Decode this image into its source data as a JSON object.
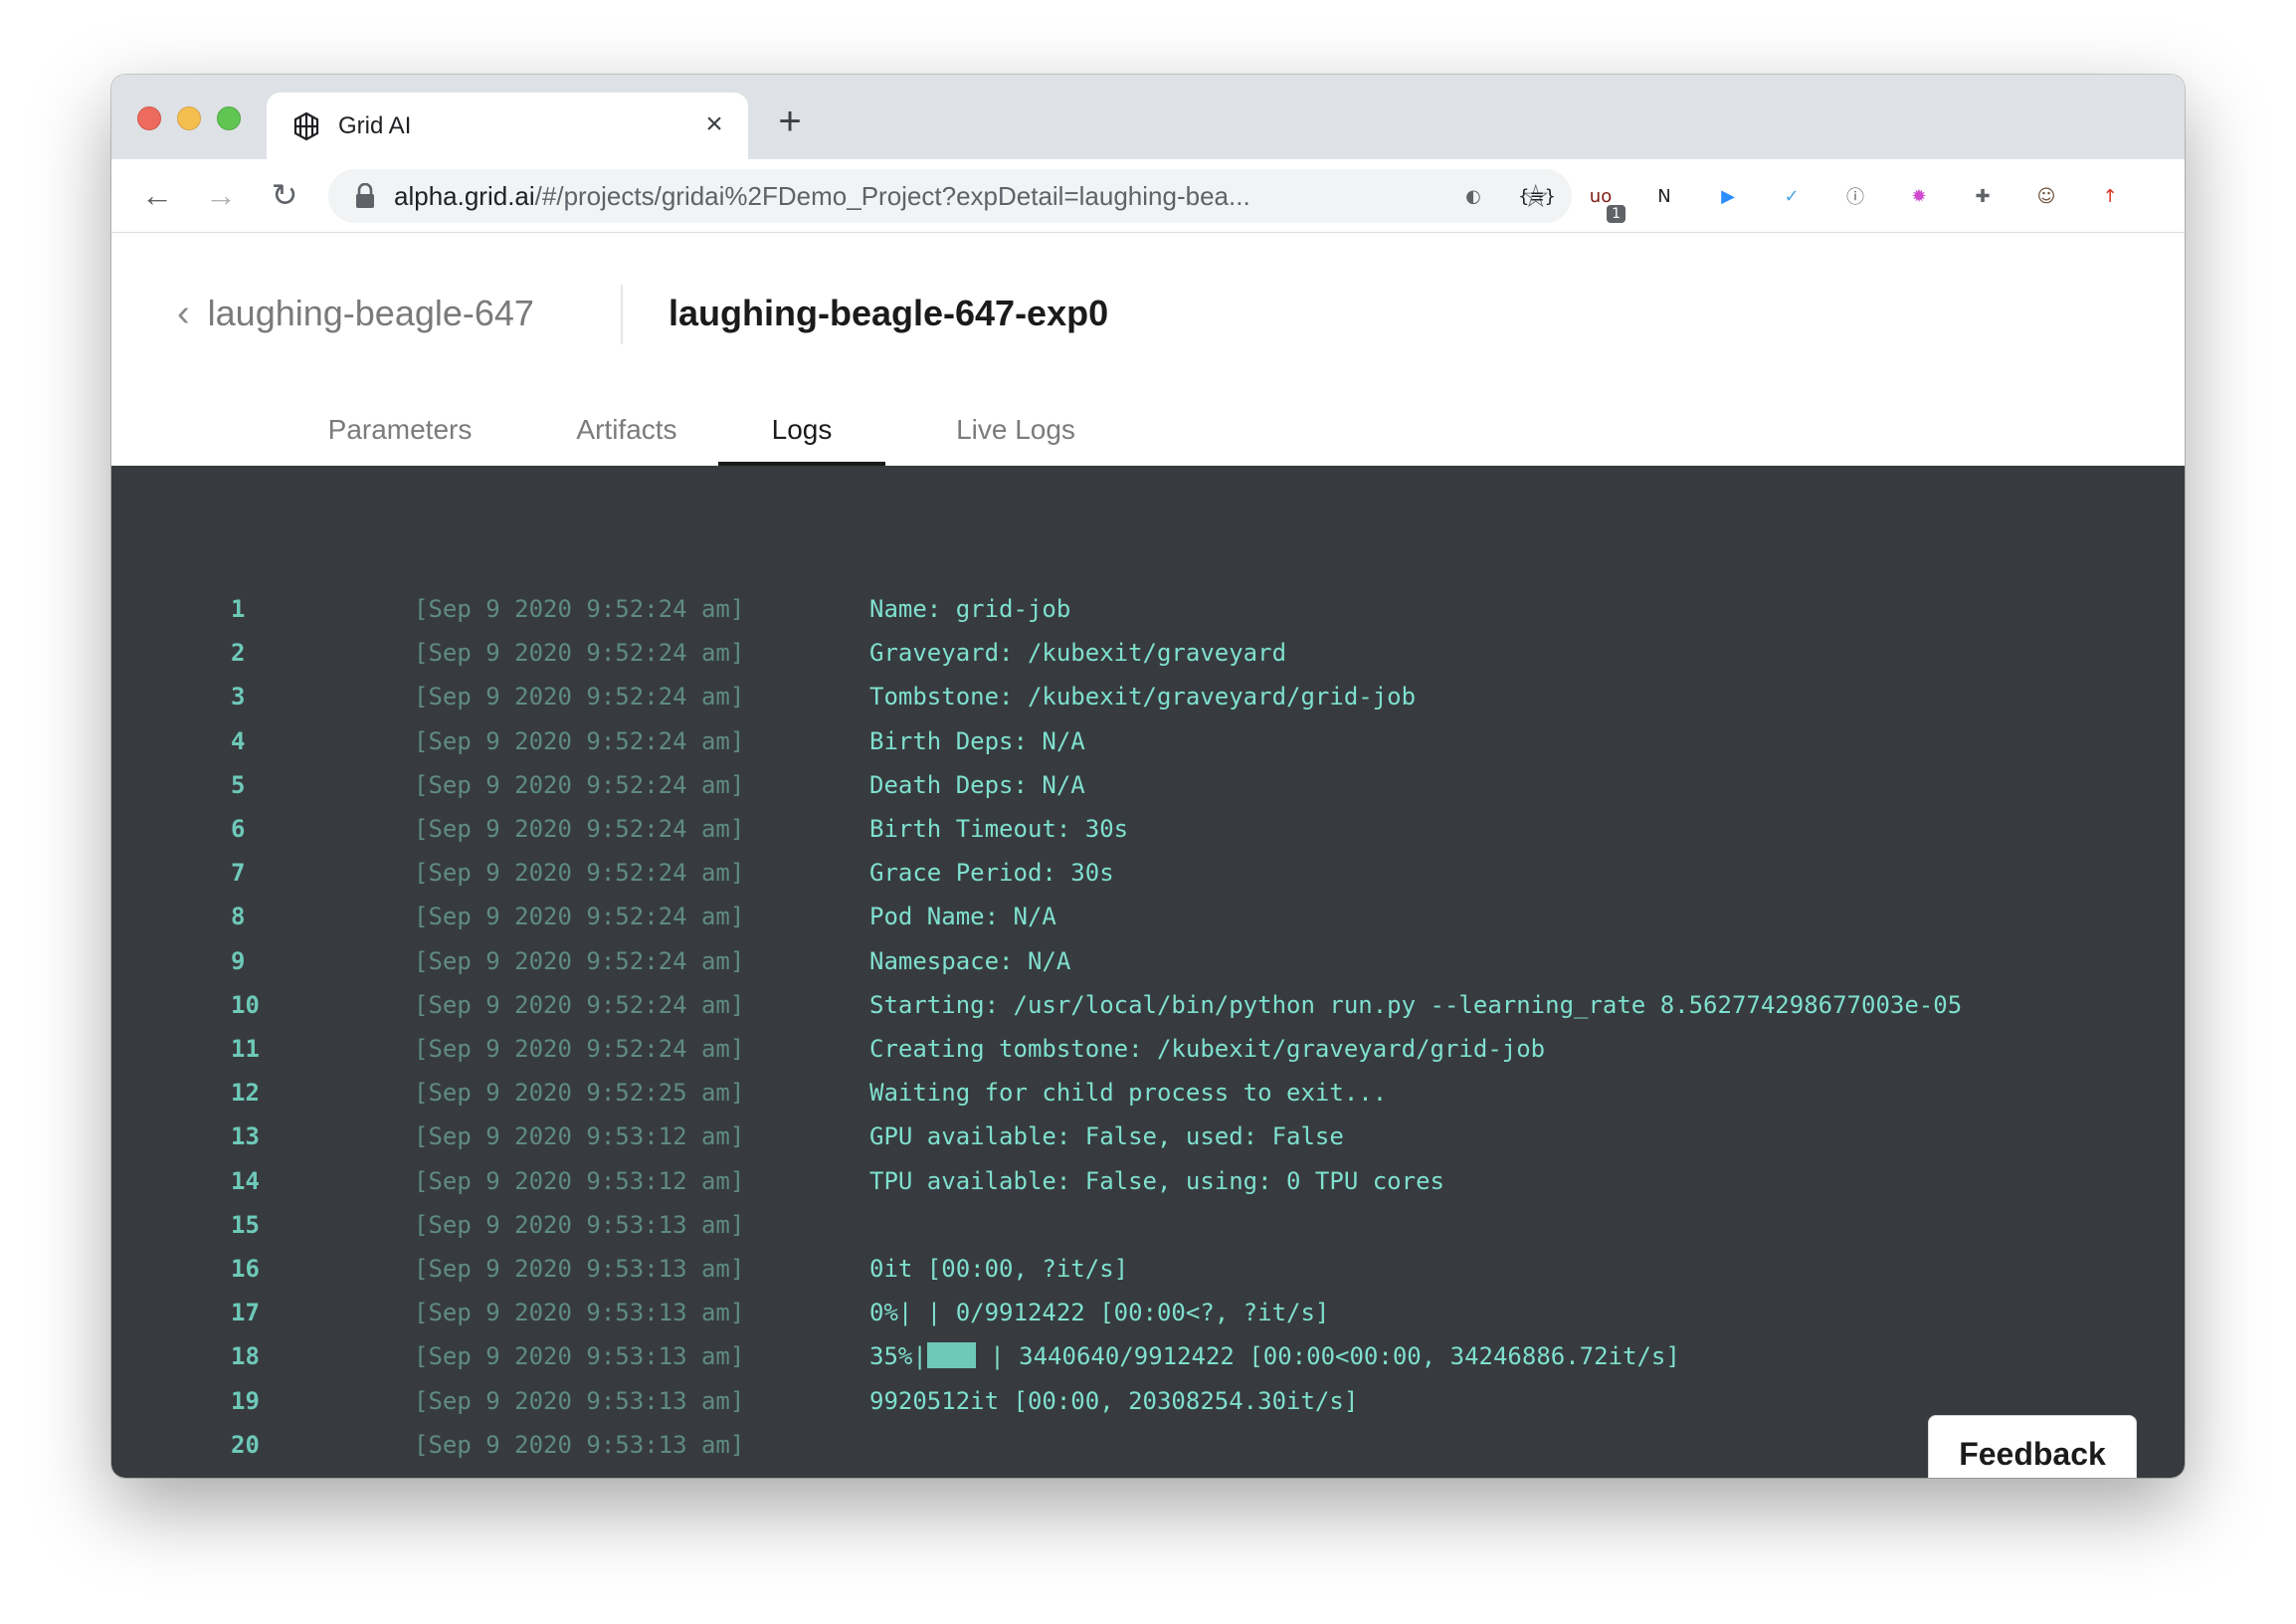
{
  "browser": {
    "tab_title": "Grid AI",
    "tab_close": "×",
    "new_tab": "+",
    "url_host": "alpha.grid.ai",
    "url_path": "/#/projects/gridai%2FDemo_Project?expDetail=laughing-bea...",
    "extensions": [
      {
        "name": "circle-extension-icon",
        "glyph": "◐"
      },
      {
        "name": "json-extension-icon",
        "glyph": "{≡}"
      },
      {
        "name": "ublock-extension-icon",
        "glyph": "uo",
        "badge": "1"
      },
      {
        "name": "notion-extension-icon",
        "glyph": "N"
      },
      {
        "name": "zoom-extension-icon",
        "glyph": "▶"
      },
      {
        "name": "tick-extension-icon",
        "glyph": "✓"
      },
      {
        "name": "onepassword-extension-icon",
        "glyph": "ⓘ"
      },
      {
        "name": "color-wheel-extension-icon",
        "glyph": "✹"
      },
      {
        "name": "puzzle-extensions-icon",
        "glyph": "✚"
      },
      {
        "name": "profile-avatar",
        "glyph": "☺"
      },
      {
        "name": "update-icon",
        "glyph": "↑"
      }
    ]
  },
  "header": {
    "parent_name": "laughing-beagle-647",
    "title": "laughing-beagle-647-exp0"
  },
  "tabs": [
    {
      "label": "Parameters",
      "active": false
    },
    {
      "label": "Artifacts",
      "active": false
    },
    {
      "label": "Logs",
      "active": true
    },
    {
      "label": "Live Logs",
      "active": false
    }
  ],
  "logs": [
    {
      "line": "1",
      "time": "[Sep 9 2020 9:52:24 am]",
      "message": "Name: grid-job"
    },
    {
      "line": "2",
      "time": "[Sep 9 2020 9:52:24 am]",
      "message": "Graveyard: /kubexit/graveyard"
    },
    {
      "line": "3",
      "time": "[Sep 9 2020 9:52:24 am]",
      "message": "Tombstone: /kubexit/graveyard/grid-job"
    },
    {
      "line": "4",
      "time": "[Sep 9 2020 9:52:24 am]",
      "message": "Birth Deps: N/A"
    },
    {
      "line": "5",
      "time": "[Sep 9 2020 9:52:24 am]",
      "message": "Death Deps: N/A"
    },
    {
      "line": "6",
      "time": "[Sep 9 2020 9:52:24 am]",
      "message": "Birth Timeout: 30s"
    },
    {
      "line": "7",
      "time": "[Sep 9 2020 9:52:24 am]",
      "message": "Grace Period: 30s"
    },
    {
      "line": "8",
      "time": "[Sep 9 2020 9:52:24 am]",
      "message": "Pod Name: N/A"
    },
    {
      "line": "9",
      "time": "[Sep 9 2020 9:52:24 am]",
      "message": "Namespace: N/A"
    },
    {
      "line": "10",
      "time": "[Sep 9 2020 9:52:24 am]",
      "message": "Starting: /usr/local/bin/python run.py --learning_rate 8.562774298677003e-05"
    },
    {
      "line": "11",
      "time": "[Sep 9 2020 9:52:24 am]",
      "message": "Creating tombstone: /kubexit/graveyard/grid-job"
    },
    {
      "line": "12",
      "time": "[Sep 9 2020 9:52:25 am]",
      "message": "Waiting for child process to exit..."
    },
    {
      "line": "13",
      "time": "[Sep 9 2020 9:53:12 am]",
      "message": "GPU available: False, used: False"
    },
    {
      "line": "14",
      "time": "[Sep 9 2020 9:53:12 am]",
      "message": "TPU available: False, using: 0 TPU cores"
    },
    {
      "line": "15",
      "time": "[Sep 9 2020 9:53:13 am]",
      "message": ""
    },
    {
      "line": "16",
      "time": "[Sep 9 2020 9:53:13 am]",
      "message": "0it [00:00, ?it/s]"
    },
    {
      "line": "17",
      "time": "[Sep 9 2020 9:53:13 am]",
      "message": "0%| | 0/9912422 [00:00<?, ?it/s]"
    },
    {
      "line": "18",
      "time": "[Sep 9 2020 9:53:13 am]",
      "message_pre": "35%|",
      "message_post": " | 3440640/9912422 [00:00<00:00, 34246886.72it/s]",
      "progress": 0.35
    },
    {
      "line": "19",
      "time": "[Sep 9 2020 9:53:13 am]",
      "message": "9920512it [00:00, 20308254.30it/s]"
    },
    {
      "line": "20",
      "time": "[Sep 9 2020 9:53:13 am]",
      "message": ""
    }
  ],
  "feedback_label": "Feedback",
  "colors": {
    "log_background": "#373b3f",
    "log_text": "#7fe0cf",
    "accent": "#6ec9b9"
  }
}
